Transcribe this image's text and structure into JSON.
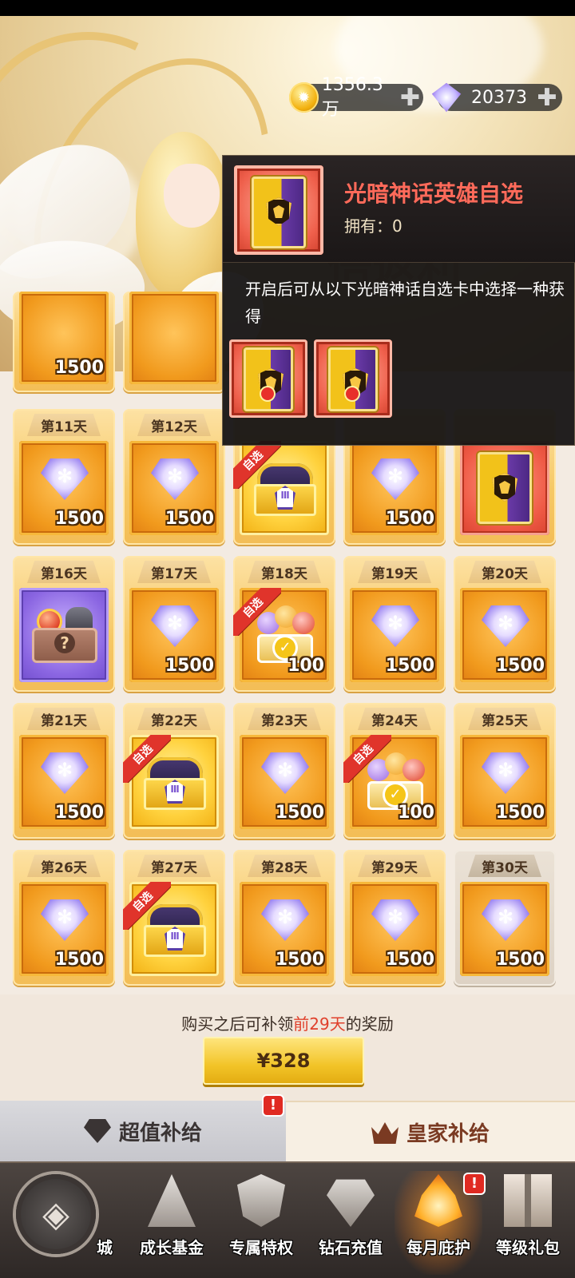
{
  "currency": {
    "gold": "1356.3万",
    "diamonds": "20373",
    "add_symbol": "✚"
  },
  "grid": {
    "partial_top_qty": "1500",
    "ribbon_label": "自选",
    "days": [
      {
        "day": "第11天",
        "reward": "diamond",
        "qty": "1500"
      },
      {
        "day": "第12天",
        "reward": "diamond",
        "qty": "1500"
      },
      {
        "day": "",
        "reward": "chest",
        "qty": "",
        "ribbon": true
      },
      {
        "day": "",
        "reward": "diamond",
        "qty": "1500"
      },
      {
        "day": "",
        "reward": "hero-card",
        "qty": ""
      },
      {
        "day": "第16天",
        "reward": "mystery",
        "qty": ""
      },
      {
        "day": "第17天",
        "reward": "diamond",
        "qty": "1500"
      },
      {
        "day": "第18天",
        "reward": "orbs",
        "qty": "100",
        "ribbon": true
      },
      {
        "day": "第19天",
        "reward": "diamond",
        "qty": "1500"
      },
      {
        "day": "第20天",
        "reward": "diamond",
        "qty": "1500"
      },
      {
        "day": "第21天",
        "reward": "diamond",
        "qty": "1500"
      },
      {
        "day": "第22天",
        "reward": "chest",
        "qty": "",
        "ribbon": true
      },
      {
        "day": "第23天",
        "reward": "diamond",
        "qty": "1500"
      },
      {
        "day": "第24天",
        "reward": "orbs",
        "qty": "100",
        "ribbon": true
      },
      {
        "day": "第25天",
        "reward": "diamond",
        "qty": "1500"
      },
      {
        "day": "第26天",
        "reward": "diamond",
        "qty": "1500"
      },
      {
        "day": "第27天",
        "reward": "chest",
        "qty": "",
        "ribbon": true
      },
      {
        "day": "第28天",
        "reward": "diamond",
        "qty": "1500"
      },
      {
        "day": "第29天",
        "reward": "diamond",
        "qty": "1500"
      },
      {
        "day": "第30天",
        "reward": "diamond",
        "qty": "1500",
        "claimed": true
      }
    ]
  },
  "tooltip": {
    "title": "光暗神话英雄自选",
    "owned": "拥有：0",
    "description": "开启后可从以下光暗神话自选卡中选择一种获得"
  },
  "purchase": {
    "bonus_prefix": "购买之后可补领",
    "bonus_highlight": "前29天",
    "bonus_suffix": "的奖励",
    "price": "¥328"
  },
  "supply_tabs": {
    "left": "超值补给",
    "right": "皇家补给",
    "alert": "!"
  },
  "bottom_nav": {
    "back_symbol": "◈",
    "items": [
      {
        "label": "城"
      },
      {
        "label": "成长基金"
      },
      {
        "label": "专属特权"
      },
      {
        "label": "钻石充值"
      },
      {
        "label": "每月庇护"
      },
      {
        "label": "等级礼包"
      }
    ],
    "alert": "!"
  },
  "colors": {
    "accent_red": "#e0402b",
    "tooltip_title": "#ff6a5a",
    "gold_button": "#f2c428"
  }
}
